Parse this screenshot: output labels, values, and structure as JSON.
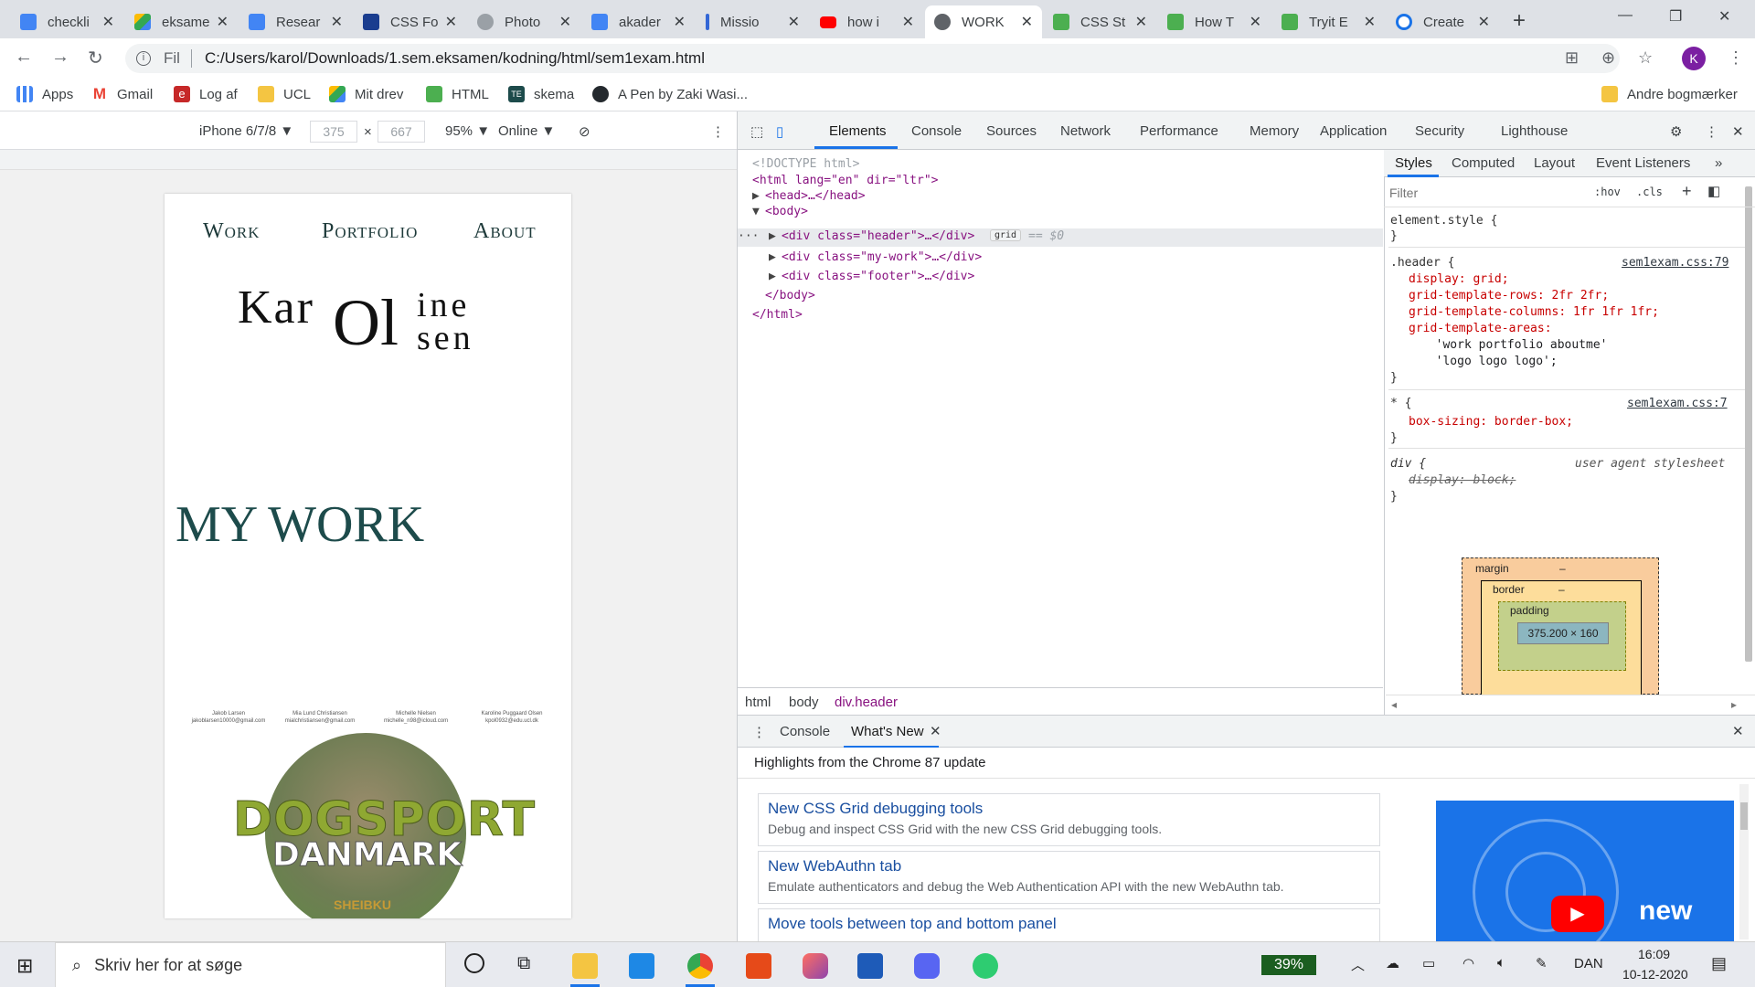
{
  "browser": {
    "tabs": [
      {
        "label": "checkli",
        "icon": "google-docs-icon",
        "color": "#4285f4"
      },
      {
        "label": "eksame",
        "icon": "google-drive-icon",
        "color": "#34a853"
      },
      {
        "label": "Resear",
        "icon": "google-docs-icon",
        "color": "#4285f4"
      },
      {
        "label": "CSS Fo",
        "icon": "fonts-icon",
        "color": "#1a3d8f"
      },
      {
        "label": "Photo",
        "icon": "link-icon",
        "color": "#5f6368"
      },
      {
        "label": "akader",
        "icon": "google-docs-icon",
        "color": "#4285f4"
      },
      {
        "label": "Missio",
        "icon": "bookmark-icon",
        "color": "#3367d6"
      },
      {
        "label": "how i",
        "icon": "youtube-icon",
        "color": "#ff0000"
      },
      {
        "label": "WORK",
        "icon": "globe-icon",
        "color": "#5f6368"
      },
      {
        "label": "CSS St",
        "icon": "w3schools-icon",
        "color": "#4caf50"
      },
      {
        "label": "How T",
        "icon": "w3schools-icon",
        "color": "#4caf50"
      },
      {
        "label": "Tryit E",
        "icon": "w3schools-icon",
        "color": "#4caf50"
      },
      {
        "label": "Create",
        "icon": "refresh-c-icon",
        "color": "#1a73e8"
      }
    ],
    "active_tab_index": 8,
    "address": {
      "scheme": "Fil",
      "url": "C:/Users/karol/Downloads/1.sem.eksamen/kodning/html/sem1exam.html"
    },
    "profile_initial": "K",
    "bookmarks": [
      {
        "label": "Apps",
        "icon": "apps-grid-icon",
        "color": "#ea4335"
      },
      {
        "label": "Gmail",
        "icon": "gmail-icon",
        "color": "#ea4335"
      },
      {
        "label": "Log af",
        "icon": "e-icon",
        "color": "#c62828"
      },
      {
        "label": "UCL",
        "icon": "folder-icon",
        "color": "#f4c542"
      },
      {
        "label": "Mit drev",
        "icon": "google-drive-icon",
        "color": "#34a853"
      },
      {
        "label": "HTML",
        "icon": "w3schools-icon",
        "color": "#4caf50"
      },
      {
        "label": "skema",
        "icon": "te-icon",
        "color": "#1d4b4b"
      },
      {
        "label": "A Pen by Zaki Wasi...",
        "icon": "github-icon",
        "color": "#24292e"
      }
    ],
    "other_bookmarks": "Andre bogmærker"
  },
  "device_toolbar": {
    "device": "iPhone 6/7/8 ▼",
    "width": "375",
    "times": "×",
    "height": "667",
    "zoom": "95% ▼",
    "network": "Online ▼"
  },
  "page": {
    "nav": [
      "Work",
      "Portfolio",
      "About"
    ],
    "logo": {
      "part1": "Kar",
      "part2": "Oline",
      "part3": "Olsen"
    },
    "logo_small_top": "ine",
    "logo_small_bottom": "sen",
    "logo_big": "Ol",
    "heading": "MY WORK",
    "members": [
      {
        "name": "Jakob Larsen",
        "email": "jakoblarsen10000@gmail.com"
      },
      {
        "name": "Mia Lund Christiansen",
        "email": "mialchristiansen@gmail.com"
      },
      {
        "name": "Michelle Nielsen",
        "email": "michelle_n98@icloud.com"
      },
      {
        "name": "Karoline Puggaard Olsen",
        "email": "kpol0932@edu.ucl.dk"
      }
    ],
    "badge": {
      "line1": "DOGSPORT",
      "line2": "DANMARK",
      "line3": "SHEIBKU"
    }
  },
  "devtools": {
    "tabs": [
      "Elements",
      "Console",
      "Sources",
      "Network",
      "Performance",
      "Memory",
      "Application",
      "Security",
      "Lighthouse"
    ],
    "dom": {
      "doctype": "<!DOCTYPE html>",
      "html_open": "<html lang=\"en\" dir=\"ltr\">",
      "head": "<head>…</head>",
      "body_open": "<body>",
      "div_header": "<div class=\"header\">…</div>",
      "grid_badge": "grid",
      "eq": "== $0",
      "div_mywork": "<div class=\"my-work\">…</div>",
      "div_footer": "<div class=\"footer\">…</div>",
      "body_close": "</body>",
      "html_close": "</html>"
    },
    "breadcrumbs": [
      "html",
      "body",
      "div.header"
    ],
    "styles_tabs": [
      "Styles",
      "Computed",
      "Layout",
      "Event Listeners"
    ],
    "filter_placeholder": "Filter",
    "hov": ":hov",
    "cls": ".cls",
    "rules": {
      "element_style": "element.style {",
      "close": "}",
      "header_selector": ".header {",
      "header_source": "sem1exam.css:79",
      "header_props": [
        "display: grid;",
        "grid-template-rows: 2fr 2fr;",
        "grid-template-columns: 1fr 1fr 1fr;",
        "grid-template-areas:",
        "  'work portfolio aboutme'",
        "  'logo logo logo';"
      ],
      "star_selector": "* {",
      "star_source": "sem1exam.css:7",
      "star_prop": "box-sizing: border-box;",
      "div_selector": "div {",
      "div_source": "user agent stylesheet",
      "div_prop": "display: block;"
    },
    "box_model": {
      "margin": "margin",
      "border": "border",
      "padding": "padding",
      "content": "375.200 × 160",
      "dash": "–"
    },
    "drawer": {
      "tabs": [
        "Console",
        "What's New"
      ],
      "headline": "Highlights from the Chrome 87 update",
      "cards": [
        {
          "title": "New CSS Grid debugging tools",
          "desc": "Debug and inspect CSS Grid with the new CSS Grid debugging tools."
        },
        {
          "title": "New WebAuthn tab",
          "desc": "Emulate authenticators and debug the Web Authentication API with the new WebAuthn tab."
        },
        {
          "title": "Move tools between top and bottom panel",
          "desc": ""
        }
      ],
      "video_text": "new"
    }
  },
  "taskbar": {
    "search_placeholder": "Skriv her for at søge",
    "battery": "39%",
    "language": "DAN",
    "time": "16:09",
    "date": "10-12-2020"
  }
}
